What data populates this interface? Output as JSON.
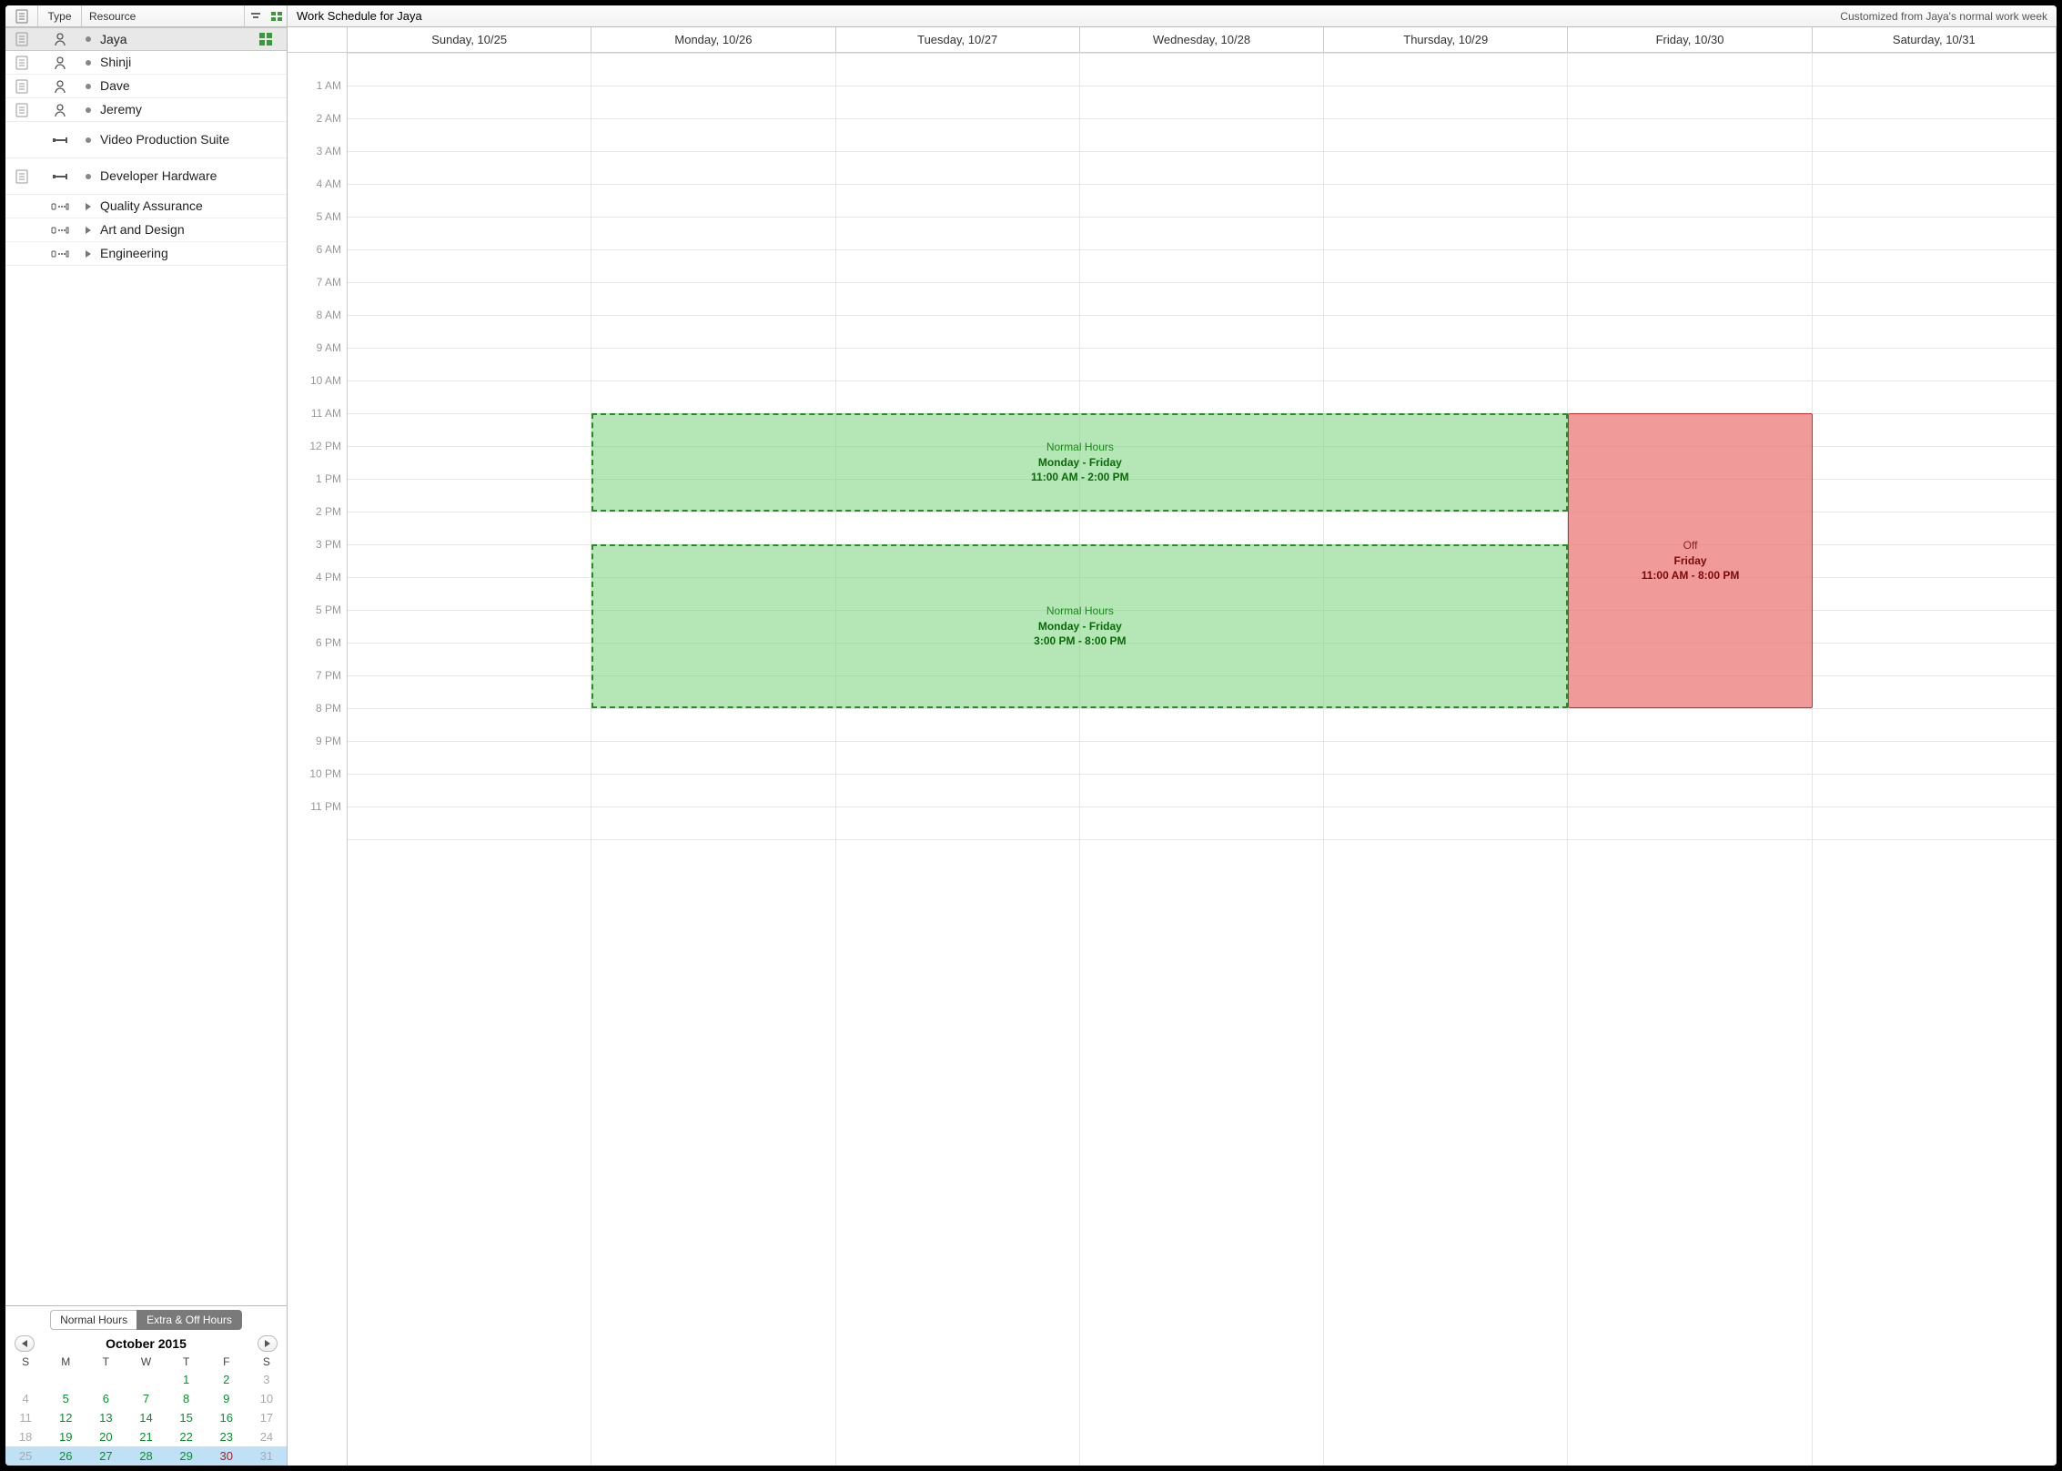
{
  "sidebarHeader": {
    "noteCol": "",
    "typeCol": "Type",
    "resourceCol": "Resource"
  },
  "resources": [
    {
      "name": "Jaya",
      "icon": "person",
      "note": true,
      "marker": "bullet",
      "selected": true,
      "indicator": "green"
    },
    {
      "name": "Shinji",
      "icon": "person",
      "note": true,
      "marker": "bullet"
    },
    {
      "name": "Dave",
      "icon": "person",
      "note": true,
      "marker": "bullet"
    },
    {
      "name": "Jeremy",
      "icon": "person",
      "note": true,
      "marker": "bullet"
    },
    {
      "name": "Video Production Suite",
      "icon": "tool",
      "note": false,
      "marker": "bullet",
      "tall": true
    },
    {
      "name": "Developer Hardware",
      "icon": "tool",
      "note": true,
      "marker": "bullet",
      "tall": true
    },
    {
      "name": "Quality Assurance",
      "icon": "group",
      "note": false,
      "marker": "disclosure"
    },
    {
      "name": "Art and Design",
      "icon": "group",
      "note": false,
      "marker": "disclosure"
    },
    {
      "name": "Engineering",
      "icon": "group",
      "note": false,
      "marker": "disclosure"
    }
  ],
  "tabs": {
    "normal": "Normal Hours",
    "extra": "Extra & Off Hours"
  },
  "calendar": {
    "title": "October 2015",
    "dows": [
      "S",
      "M",
      "T",
      "W",
      "T",
      "F",
      "S"
    ],
    "rows": [
      [
        {
          "d": "",
          "c": ""
        },
        {
          "d": "",
          "c": ""
        },
        {
          "d": "",
          "c": ""
        },
        {
          "d": "",
          "c": ""
        },
        {
          "d": "1",
          "c": "green"
        },
        {
          "d": "2",
          "c": "green"
        },
        {
          "d": "3",
          "c": "dim"
        }
      ],
      [
        {
          "d": "4",
          "c": "dim"
        },
        {
          "d": "5",
          "c": "green"
        },
        {
          "d": "6",
          "c": "green"
        },
        {
          "d": "7",
          "c": "green"
        },
        {
          "d": "8",
          "c": "green"
        },
        {
          "d": "9",
          "c": "green"
        },
        {
          "d": "10",
          "c": "dim"
        }
      ],
      [
        {
          "d": "11",
          "c": "dim"
        },
        {
          "d": "12",
          "c": "green"
        },
        {
          "d": "13",
          "c": "green"
        },
        {
          "d": "14",
          "c": "green"
        },
        {
          "d": "15",
          "c": "green"
        },
        {
          "d": "16",
          "c": "green"
        },
        {
          "d": "17",
          "c": "dim"
        }
      ],
      [
        {
          "d": "18",
          "c": "dim"
        },
        {
          "d": "19",
          "c": "green"
        },
        {
          "d": "20",
          "c": "green"
        },
        {
          "d": "21",
          "c": "green"
        },
        {
          "d": "22",
          "c": "green"
        },
        {
          "d": "23",
          "c": "green"
        },
        {
          "d": "24",
          "c": "dim"
        }
      ],
      [
        {
          "d": "25",
          "c": "dim"
        },
        {
          "d": "26",
          "c": "green"
        },
        {
          "d": "27",
          "c": "green"
        },
        {
          "d": "28",
          "c": "green"
        },
        {
          "d": "29",
          "c": "green"
        },
        {
          "d": "30",
          "c": "red"
        },
        {
          "d": "31",
          "c": "dim"
        }
      ]
    ],
    "highlightRow": 4
  },
  "schedule": {
    "title": "Work Schedule for Jaya",
    "subtitle": "Customized from Jaya's normal work week",
    "days": [
      "Sunday, 10/25",
      "Monday, 10/26",
      "Tuesday, 10/27",
      "Wednesday, 10/28",
      "Thursday, 10/29",
      "Friday, 10/30",
      "Saturday, 10/31"
    ],
    "hours": [
      "1 AM",
      "2 AM",
      "3 AM",
      "4 AM",
      "5 AM",
      "6 AM",
      "7 AM",
      "8 AM",
      "9 AM",
      "10 AM",
      "11 AM",
      "12 PM",
      "1 PM",
      "2 PM",
      "3 PM",
      "4 PM",
      "5 PM",
      "6 PM",
      "7 PM",
      "8 PM",
      "9 PM",
      "10 PM",
      "11 PM"
    ],
    "hourHeight": 36,
    "blocks": [
      {
        "type": "green",
        "dayStart": 1,
        "daySpan": 4,
        "hourStart": 11,
        "hourEnd": 14,
        "title": "Normal Hours",
        "line1": "Monday - Friday",
        "line2": "11:00 AM - 2:00 PM"
      },
      {
        "type": "green",
        "dayStart": 1,
        "daySpan": 4,
        "hourStart": 15,
        "hourEnd": 20,
        "title": "Normal Hours",
        "line1": "Monday - Friday",
        "line2": "3:00 PM - 8:00 PM"
      },
      {
        "type": "red",
        "dayStart": 5,
        "daySpan": 1,
        "hourStart": 11,
        "hourEnd": 20,
        "title": "Off",
        "line1": "Friday",
        "line2": "11:00 AM - 8:00 PM"
      }
    ]
  }
}
